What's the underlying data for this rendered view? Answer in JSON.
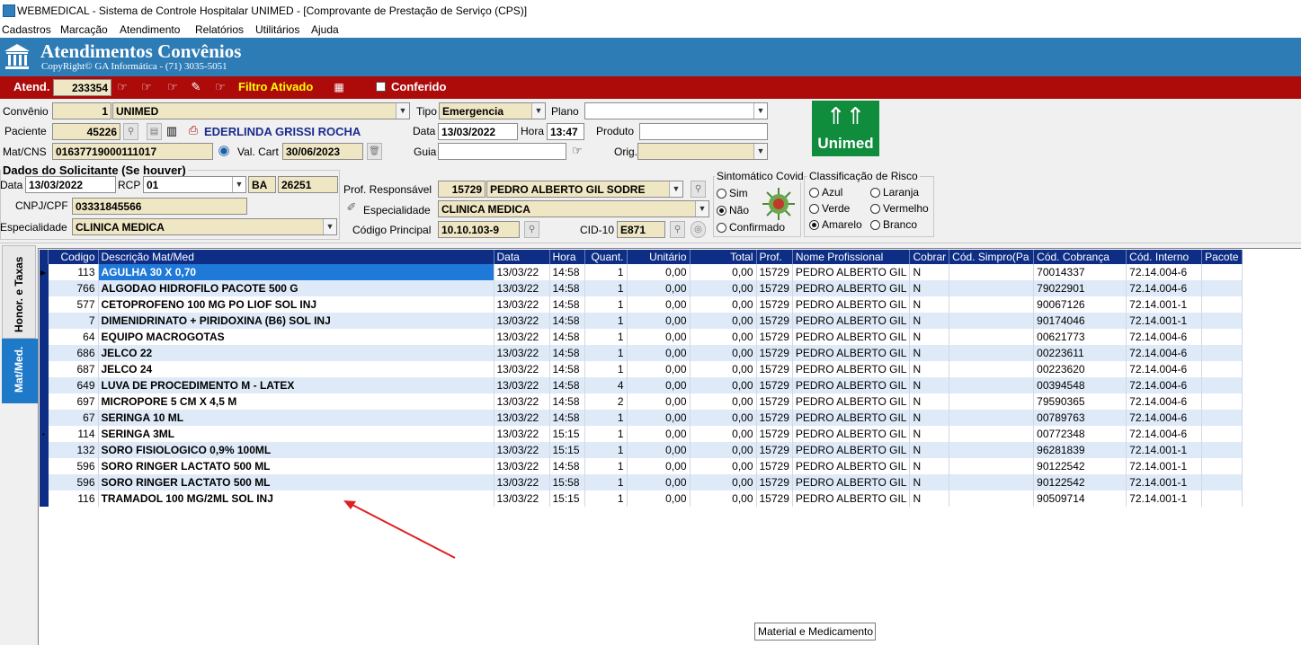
{
  "window": {
    "title": "WEBMEDICAL - Sistema de Controle Hospitalar UNIMED - [Comprovante de Prestação de Serviço  (CPS)]"
  },
  "menu": [
    "Cadastros",
    "Marcação",
    "Atendimento",
    "Relatórios",
    "Utilitários",
    "Ajuda"
  ],
  "banner": {
    "title": "Atendimentos Convênios",
    "copyright": "CopyRight© GA Informática - (71) 3035-5051"
  },
  "toolbar": {
    "atend_label": "Atend.",
    "atend_value": "233354",
    "filtro": "Filtro Ativado",
    "conferido_label": "Conferido"
  },
  "form": {
    "convenio_label": "Convênio",
    "convenio_code": "1",
    "convenio_name": "UNIMED",
    "tipo_label": "Tipo",
    "tipo_value": "Emergencia",
    "plano_label": "Plano",
    "plano_value": "",
    "paciente_label": "Paciente",
    "paciente_code": "45226",
    "paciente_name": "EDERLINDA GRISSI ROCHA",
    "data_label": "Data",
    "data_value": "13/03/2022",
    "hora_label": "Hora",
    "hora_value": "13:47",
    "produto_label": "Produto",
    "matcns_label": "Mat/CNS",
    "matcns_value": "01637719000111017",
    "valcart_label": "Val. Cart",
    "valcart_value": "30/06/2023",
    "guia_label": "Guia",
    "orig_label": "Orig."
  },
  "solicitante": {
    "title": "Dados do Solicitante (Se houver)",
    "data_label": "Data",
    "data_value": "13/03/2022",
    "rcp_label": "RCP",
    "rcp_value": "01",
    "uf_value": "BA",
    "num_value": "26251",
    "cnpj_label": "CNPJ/CPF",
    "cnpj_value": "03331845566",
    "esp_label": "Especialidade",
    "esp_value": "CLINICA MEDICA"
  },
  "responsavel": {
    "prof_label": "Prof. Responsável",
    "prof_code": "15729",
    "prof_name": "PEDRO ALBERTO GIL  SODRE",
    "esp_label": "Especialidade",
    "esp_value": "CLINICA MEDICA",
    "codigo_label": "Código Principal",
    "codigo_value": "10.10.103-9",
    "cid_label": "CID-10",
    "cid_value": "E871"
  },
  "sintomatico": {
    "title": "Sintomático Covid",
    "options": [
      "Sim",
      "Não",
      "Confirmado"
    ],
    "selected": "Não"
  },
  "risco": {
    "title": "Classificação de Risco",
    "options": [
      "Azul",
      "Laranja",
      "Verde",
      "Vermelho",
      "Amarelo",
      "Branco"
    ],
    "selected": "Amarelo"
  },
  "logo": {
    "text": "Unimed",
    "color": "#0f8c3c"
  },
  "tabs": [
    "Honor. e Taxas",
    "Mat/Med."
  ],
  "grid": {
    "columns": [
      "Codigo",
      "Descrição Mat/Med",
      "Data",
      "Hora",
      "Quant.",
      "Unitário",
      "Total",
      "Prof.",
      "Nome Profissional",
      "Cobrar",
      "Cód. Simpro(Pa",
      "Cód. Cobrança",
      "Cód. Interno",
      "Pacote"
    ],
    "rows": [
      [
        "113",
        "AGULHA 30 X 0,70",
        "13/03/22",
        "14:58",
        "1",
        "0,00",
        "0,00",
        "15729",
        "PEDRO ALBERTO GIL",
        "N",
        "",
        "70014337",
        "72.14.004-6",
        ""
      ],
      [
        "766",
        "ALGODAO HIDROFILO PACOTE 500 G",
        "13/03/22",
        "14:58",
        "1",
        "0,00",
        "0,00",
        "15729",
        "PEDRO ALBERTO GIL",
        "N",
        "",
        "79022901",
        "72.14.004-6",
        ""
      ],
      [
        "577",
        "CETOPROFENO 100 MG PO LIOF SOL INJ",
        "13/03/22",
        "14:58",
        "1",
        "0,00",
        "0,00",
        "15729",
        "PEDRO ALBERTO GIL",
        "N",
        "",
        "90067126",
        "72.14.001-1",
        ""
      ],
      [
        "7",
        "DIMENIDRINATO + PIRIDOXINA (B6) SOL INJ",
        "13/03/22",
        "14:58",
        "1",
        "0,00",
        "0,00",
        "15729",
        "PEDRO ALBERTO GIL",
        "N",
        "",
        "90174046",
        "72.14.001-1",
        ""
      ],
      [
        "64",
        "EQUIPO MACROGOTAS",
        "13/03/22",
        "14:58",
        "1",
        "0,00",
        "0,00",
        "15729",
        "PEDRO ALBERTO GIL",
        "N",
        "",
        "00621773",
        "72.14.004-6",
        ""
      ],
      [
        "686",
        "JELCO 22",
        "13/03/22",
        "14:58",
        "1",
        "0,00",
        "0,00",
        "15729",
        "PEDRO ALBERTO GIL",
        "N",
        "",
        "00223611",
        "72.14.004-6",
        ""
      ],
      [
        "687",
        "JELCO 24",
        "13/03/22",
        "14:58",
        "1",
        "0,00",
        "0,00",
        "15729",
        "PEDRO ALBERTO GIL",
        "N",
        "",
        "00223620",
        "72.14.004-6",
        ""
      ],
      [
        "649",
        "LUVA DE PROCEDIMENTO M - LATEX",
        "13/03/22",
        "14:58",
        "4",
        "0,00",
        "0,00",
        "15729",
        "PEDRO ALBERTO GIL",
        "N",
        "",
        "00394548",
        "72.14.004-6",
        ""
      ],
      [
        "697",
        "MICROPORE  5 CM X 4,5 M",
        "13/03/22",
        "14:58",
        "2",
        "0,00",
        "0,00",
        "15729",
        "PEDRO ALBERTO GIL",
        "N",
        "",
        "79590365",
        "72.14.004-6",
        ""
      ],
      [
        "67",
        "SERINGA 10 ML",
        "13/03/22",
        "14:58",
        "1",
        "0,00",
        "0,00",
        "15729",
        "PEDRO ALBERTO GIL",
        "N",
        "",
        "00789763",
        "72.14.004-6",
        ""
      ],
      [
        "114",
        "SERINGA 3ML",
        "13/03/22",
        "15:15",
        "1",
        "0,00",
        "0,00",
        "15729",
        "PEDRO ALBERTO GIL",
        "N",
        "",
        "00772348",
        "72.14.004-6",
        ""
      ],
      [
        "132",
        "SORO FISIOLOGICO 0,9% 100ML",
        "13/03/22",
        "15:15",
        "1",
        "0,00",
        "0,00",
        "15729",
        "PEDRO ALBERTO GIL",
        "N",
        "",
        "96281839",
        "72.14.001-1",
        ""
      ],
      [
        "596",
        "SORO RINGER LACTATO 500 ML",
        "13/03/22",
        "14:58",
        "1",
        "0,00",
        "0,00",
        "15729",
        "PEDRO ALBERTO GIL",
        "N",
        "",
        "90122542",
        "72.14.001-1",
        ""
      ],
      [
        "596",
        "SORO RINGER LACTATO 500 ML",
        "13/03/22",
        "15:58",
        "1",
        "0,00",
        "0,00",
        "15729",
        "PEDRO ALBERTO GIL",
        "N",
        "",
        "90122542",
        "72.14.001-1",
        ""
      ],
      [
        "116",
        "TRAMADOL 100 MG/2ML SOL INJ",
        "13/03/22",
        "15:15",
        "1",
        "0,00",
        "0,00",
        "15729",
        "PEDRO ALBERTO GIL",
        "N",
        "",
        "90509714",
        "72.14.001-1",
        ""
      ]
    ]
  },
  "tooltip": "Material e Medicamento",
  "colors": {
    "banner": "#2e7cb6",
    "redbar": "#ad0a0a",
    "grid_header": "#0e2e86",
    "field": "#efe6c4"
  }
}
